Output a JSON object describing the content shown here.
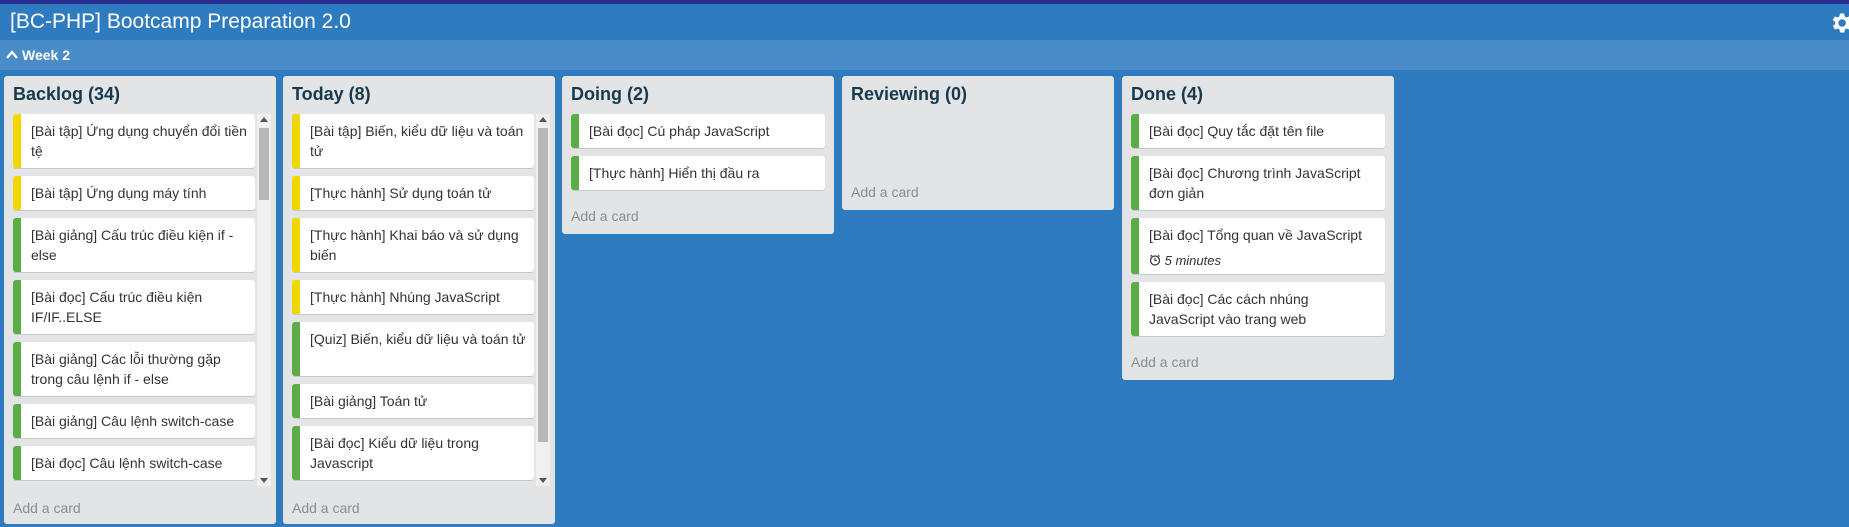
{
  "board": {
    "title": "[BC-PHP] Bootcamp Preparation 2.0",
    "settings_icon": "gear-icon"
  },
  "swimlane": {
    "title": "Week 2",
    "icon": "chevron-up-icon"
  },
  "colors": {
    "green": "#5aac44",
    "yellow": "#f2d600",
    "background": "#2f7bbf"
  },
  "lists": {
    "backlog": {
      "title": "Backlog (34)",
      "add_card": "Add a card",
      "cards": [
        {
          "text": "[Bài tập] Ứng dụng chuyển đổi tiền tệ",
          "label": "yellow"
        },
        {
          "text": "[Bài tập] Ứng dụng máy tính",
          "label": "yellow"
        },
        {
          "text": "[Bài giảng] Cấu trúc điều kiện if - else",
          "label": "green"
        },
        {
          "text": "[Bài đọc] Cấu trúc điều kiện IF/IF..ELSE",
          "label": "green"
        },
        {
          "text": "[Bài giảng] Các lỗi thường gặp trong câu lệnh if - else",
          "label": "green"
        },
        {
          "text": "[Bài giảng] Câu lệnh switch-case",
          "label": "green"
        },
        {
          "text": "[Bài đọc] Câu lệnh switch-case",
          "label": "green"
        }
      ]
    },
    "today": {
      "title": "Today (8)",
      "add_card": "Add a card",
      "cards": [
        {
          "text": "[Bài tập] Biến, kiểu dữ liệu và toán tử",
          "label": "yellow"
        },
        {
          "text": "[Thực hành] Sử dụng toán tử",
          "label": "yellow"
        },
        {
          "text": "[Thực hành] Khai báo và sử dụng biến",
          "label": "yellow"
        },
        {
          "text": "[Thực hành] Nhúng JavaScript",
          "label": "yellow"
        },
        {
          "text": "[Quiz] Biến, kiểu dữ liệu và toán tử",
          "label": "green"
        },
        {
          "text": "[Bài giảng] Toán tử",
          "label": "green"
        },
        {
          "text": "[Bài đọc] Kiểu dữ liệu trong Javascript",
          "label": "green"
        }
      ]
    },
    "doing": {
      "title": "Doing (2)",
      "add_card": "Add a card",
      "cards": [
        {
          "text": "[Bài đọc] Cú pháp JavaScript",
          "label": "green"
        },
        {
          "text": "[Thực hành] Hiển thị đầu ra",
          "label": "green"
        }
      ]
    },
    "reviewing": {
      "title": "Reviewing (0)",
      "add_card": "Add a card",
      "cards": []
    },
    "done": {
      "title": "Done (4)",
      "add_card": "Add a card",
      "cards": [
        {
          "text": "[Bài đọc] Quy tắc đặt tên file",
          "label": "green"
        },
        {
          "text": "[Bài đọc] Chương trình JavaScript đơn giản",
          "label": "green"
        },
        {
          "text": "[Bài đọc] Tổng quan về JavaScript",
          "label": "green",
          "meta": "5 minutes",
          "meta_icon": "clock-icon"
        },
        {
          "text": "[Bài đọc] Các cách nhúng JavaScript vào trang web",
          "label": "green"
        }
      ]
    }
  }
}
